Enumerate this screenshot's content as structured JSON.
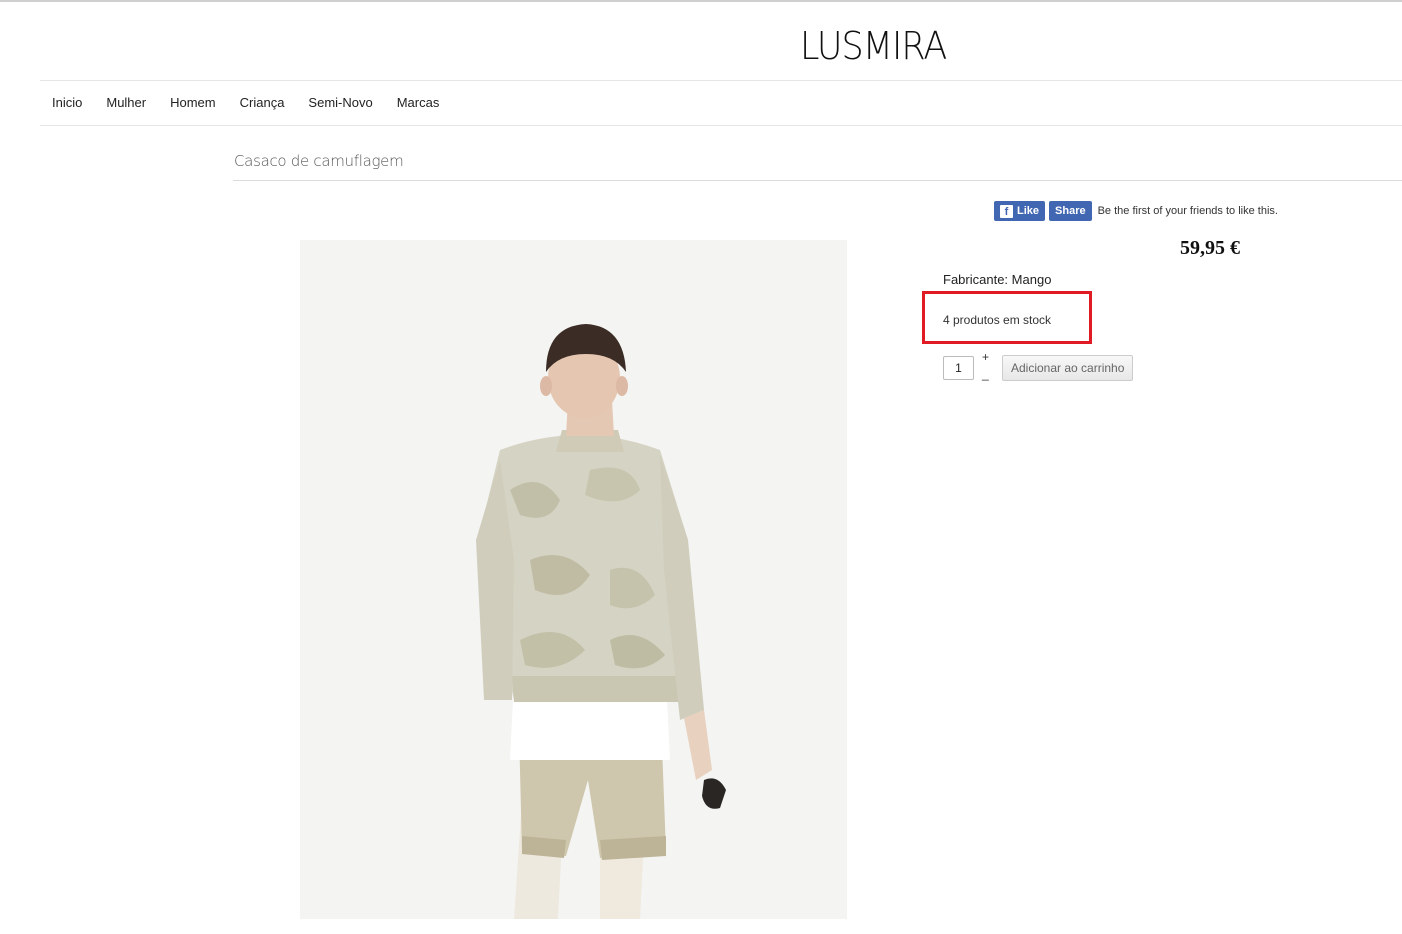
{
  "header": {
    "logo": "LUSMIRA"
  },
  "nav": {
    "items": [
      {
        "label": "Inicio"
      },
      {
        "label": "Mulher"
      },
      {
        "label": "Homem"
      },
      {
        "label": "Criança"
      },
      {
        "label": "Semi-Novo"
      },
      {
        "label": "Marcas"
      }
    ]
  },
  "product": {
    "title": "Casaco de camuflagem",
    "price": "59,95 €",
    "manufacturer_label": "Fabricante:",
    "manufacturer_value": "Mango",
    "stock_text": "4 produtos em stock",
    "quantity": "1",
    "plus_label": "+",
    "minus_label": "_",
    "add_to_cart_label": "Adicionar ao carrinho",
    "image_icon": "camouflage-jacket-model-photo"
  },
  "social": {
    "like_label": "Like",
    "share_label": "Share",
    "text": "Be the first of your friends to like this.",
    "fb_icon": "facebook-icon",
    "color": "#4267b2"
  },
  "colors": {
    "highlight": "#e01b24"
  }
}
